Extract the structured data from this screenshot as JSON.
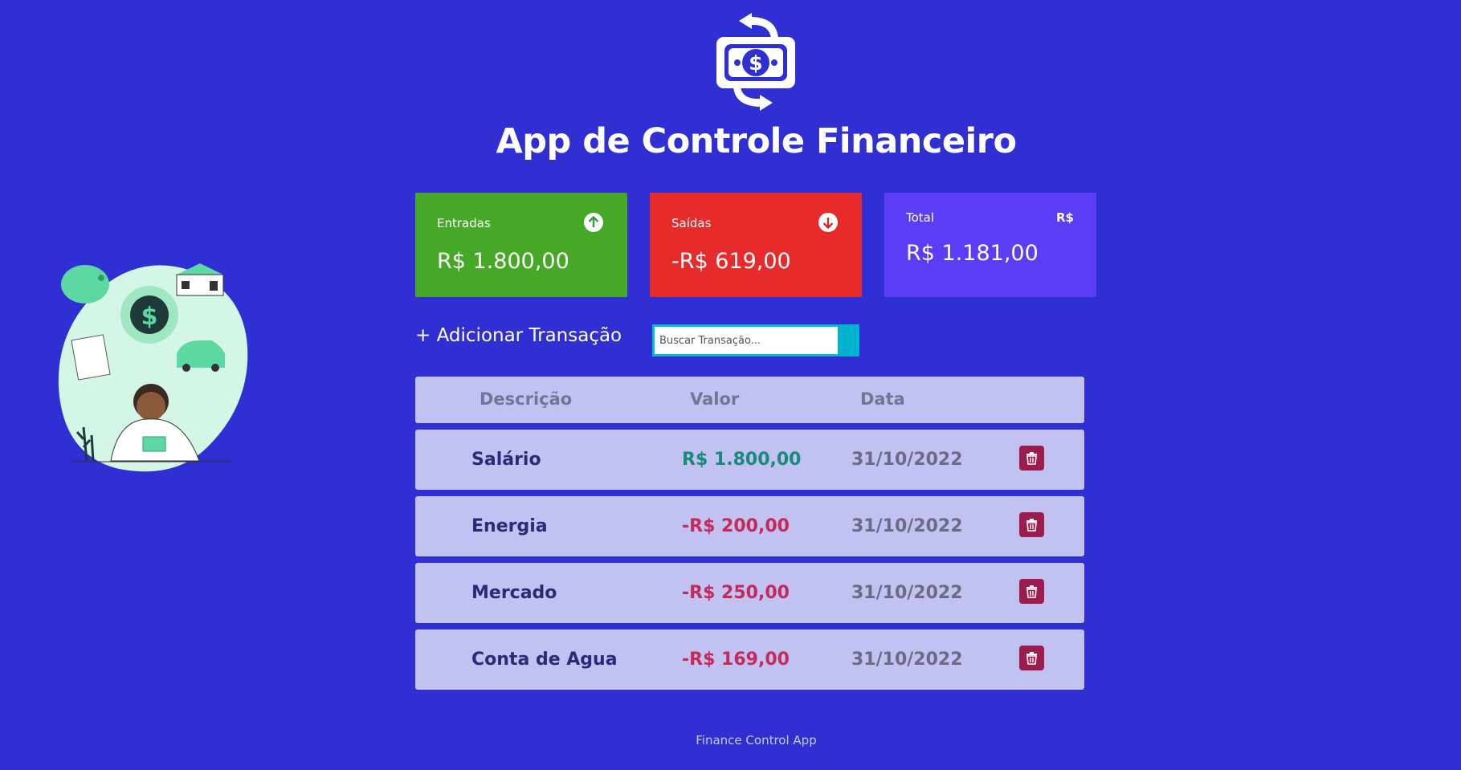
{
  "app": {
    "title": "App de Controle Financeiro",
    "footer": "Finance Control App"
  },
  "cards": {
    "income": {
      "label": "Entradas",
      "value": "R$ 1.800,00",
      "icon": "arrow-up-circle-icon",
      "color": "#46a827"
    },
    "expense": {
      "label": "Saídas",
      "value": "-R$ 619,00",
      "icon": "arrow-down-circle-icon",
      "color": "#e72a2a"
    },
    "total": {
      "label": "Total",
      "value": "R$ 1.181,00",
      "symbol": "R$",
      "color": "#5b3df5"
    }
  },
  "actions": {
    "add_label": "+ Adicionar Transação",
    "search_placeholder": "Buscar Transação..."
  },
  "table": {
    "headers": {
      "description": "Descrição",
      "value": "Valor",
      "date": "Data"
    },
    "rows": [
      {
        "description": "Salário",
        "value": "R$ 1.800,00",
        "date": "31/10/2022",
        "type": "income"
      },
      {
        "description": "Energia",
        "value": "-R$ 200,00",
        "date": "31/10/2022",
        "type": "expense"
      },
      {
        "description": "Mercado",
        "value": "-R$ 250,00",
        "date": "31/10/2022",
        "type": "expense"
      },
      {
        "description": "Conta de Agua",
        "value": "-R$ 169,00",
        "date": "31/10/2022",
        "type": "expense"
      }
    ]
  },
  "colors": {
    "background": "#2f2fd4",
    "row_bg": "#c1c1f2",
    "income_text": "#188a7a",
    "expense_text": "#c42a5a",
    "delete_button": "#9b1c4d",
    "search_accent": "#00bcd4"
  }
}
